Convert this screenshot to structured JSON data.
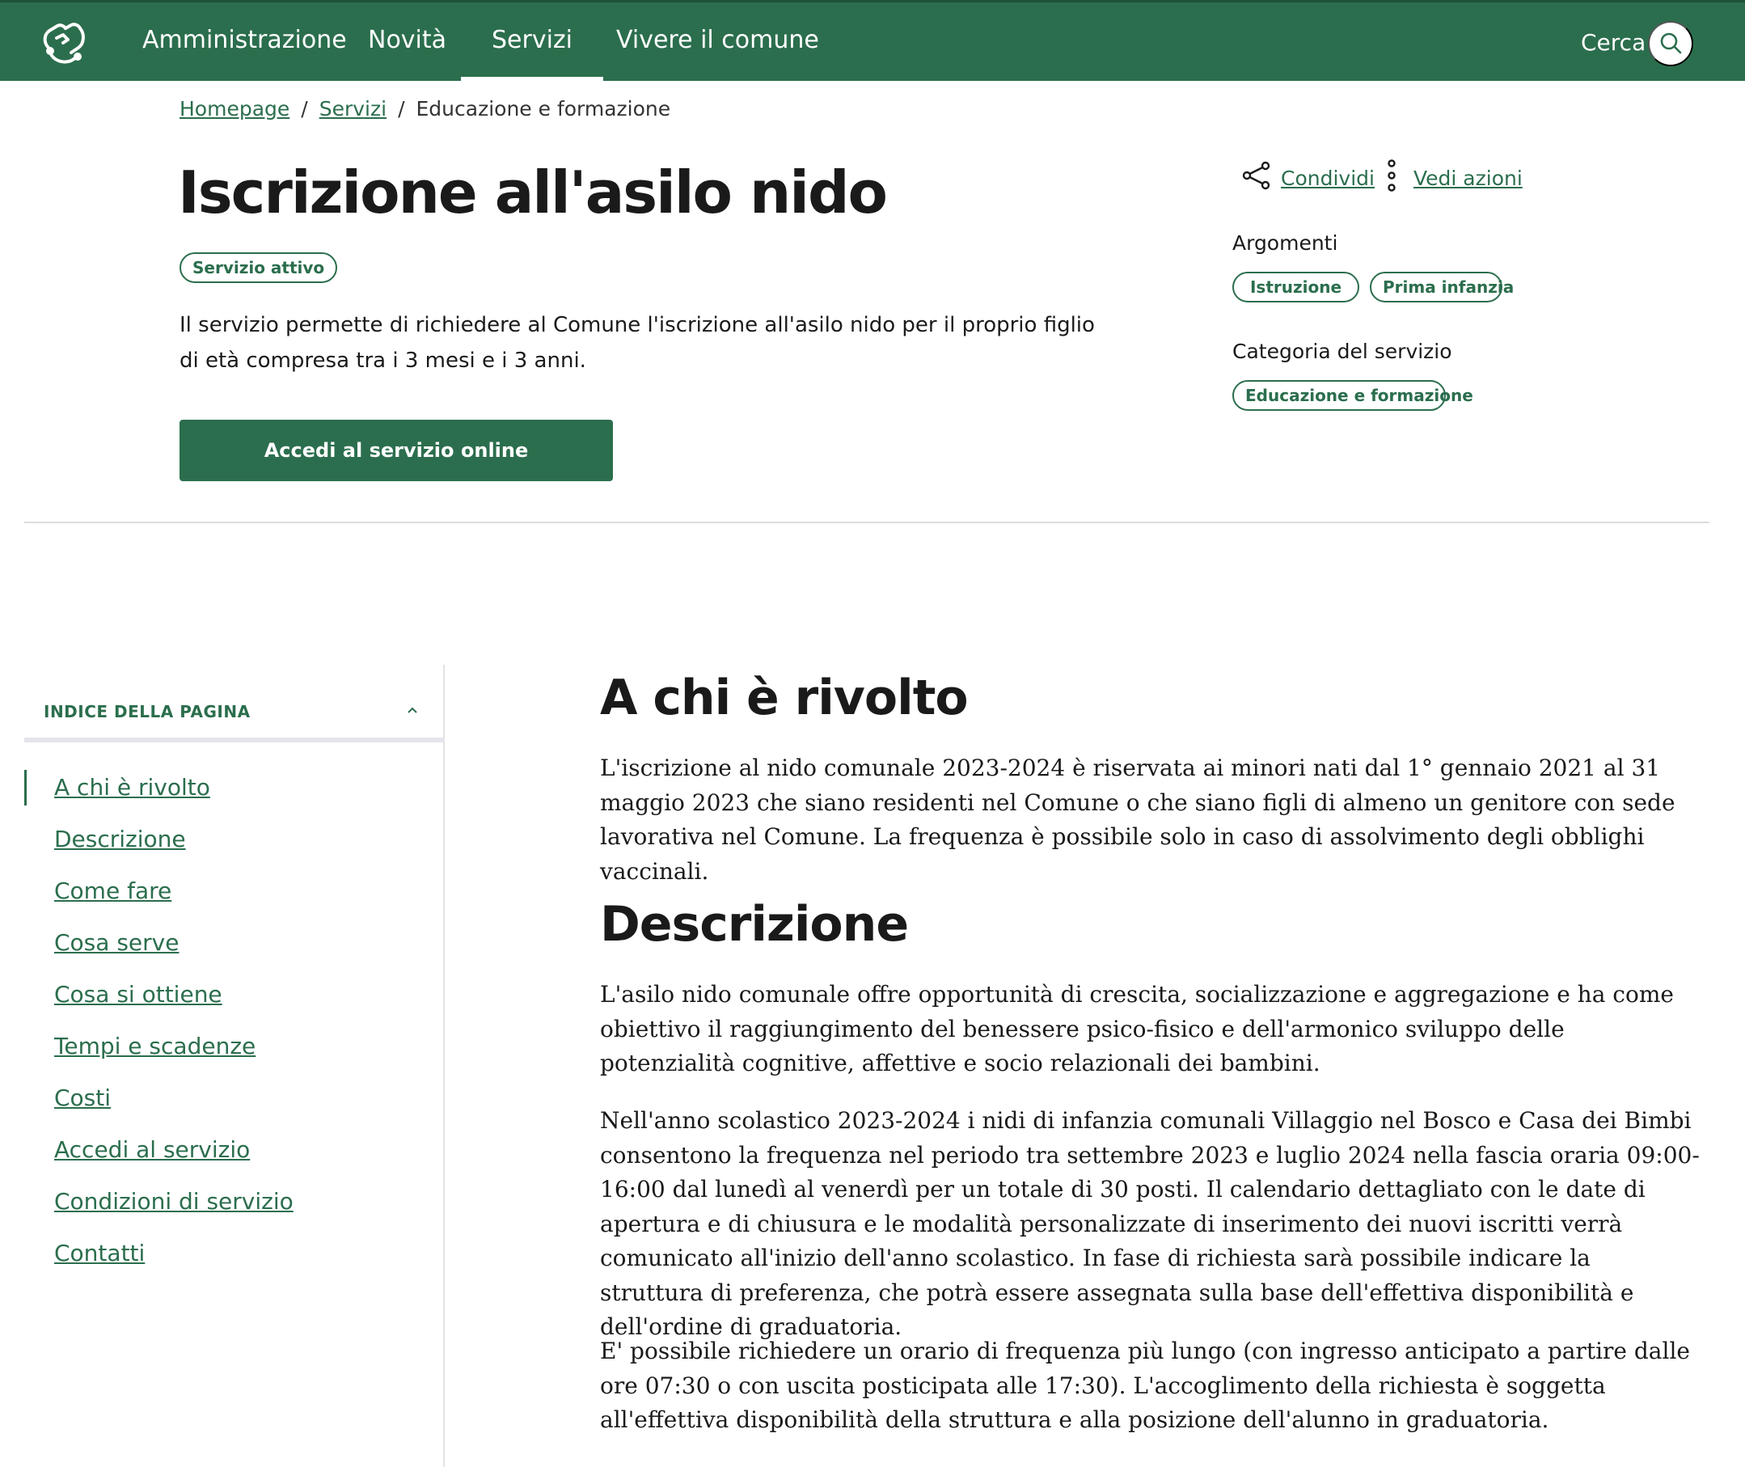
{
  "header": {
    "nav": [
      "Amministrazione",
      "Novità",
      "Servizi",
      "Vivere il comune"
    ],
    "active_nav": "Servizi",
    "search_label": "Cerca",
    "brand_color": "#2b6e4d"
  },
  "breadcrumb": {
    "home": "Homepage",
    "section": "Servizi",
    "current": "Educazione e formazione",
    "separator": "/"
  },
  "hero": {
    "title": "Iscrizione all'asilo nido",
    "status": "Servizio attivo",
    "lead": "Il servizio permette di richiedere al Comune l'iscrizione all'asilo nido per il proprio figlio di età compresa tra i 3 mesi e i 3 anni.",
    "cta": "Accedi al servizio online"
  },
  "meta": {
    "share": "Condividi",
    "actions": "Vedi azioni",
    "topics_label": "Argomenti",
    "topics": [
      "Istruzione",
      "Prima infanzia"
    ],
    "category_label": "Categoria del servizio",
    "category": "Educazione e formazione"
  },
  "index": {
    "title": "INDICE DELLA PAGINA",
    "items": [
      "A chi è rivolto",
      "Descrizione",
      "Come fare",
      "Cosa serve",
      "Cosa si ottiene",
      "Tempi e scadenze",
      "Costi",
      "Accedi al servizio",
      "Condizioni di servizio",
      "Contatti"
    ],
    "active": "A chi è rivolto"
  },
  "content": {
    "who_title": "A chi è rivolto",
    "who_text": "L'iscrizione al nido comunale 2023-2024 è riservata ai minori nati dal 1° gennaio 2021 al 31 maggio 2023 che siano residenti nel Comune o che siano figli di almeno un genitore con sede lavorativa nel Comune. La frequenza è possibile solo in caso di assolvimento degli obblighi vaccinali.",
    "desc_title": "Descrizione",
    "desc_p1": "L'asilo nido comunale offre opportunità di crescita, socializzazione e aggregazione e ha come obiettivo il raggiungimento del benessere psico-fisico e dell'armonico sviluppo delle potenzialità cognitive, affettive e socio relazionali dei bambini.",
    "desc_p2": "Nell'anno scolastico 2023-2024 i nidi di infanzia comunali Villaggio nel Bosco e Casa dei Bimbi consentono la frequenza nel periodo tra settembre 2023 e luglio 2024 nella fascia oraria 09:00-16:00 dal lunedì al venerdì per un totale di 30 posti. Il calendario dettagliato con le date di apertura e di chiusura e le modalità personalizzate di inserimento dei nuovi iscritti verrà comunicato all'inizio dell'anno scolastico. In fase di richiesta sarà possibile indicare la struttura di preferenza, che potrà essere assegnata sulla base dell'effettiva disponibilità e dell'ordine di graduatoria.",
    "desc_p3": "E' possibile richiedere un orario di frequenza più lungo (con ingresso anticipato a partire dalle ore 07:30 o con uscita posticipata alle 17:30). L'accoglimento della richiesta è soggetta all'effettiva disponibilità della struttura e alla posizione dell'alunno in graduatoria."
  }
}
